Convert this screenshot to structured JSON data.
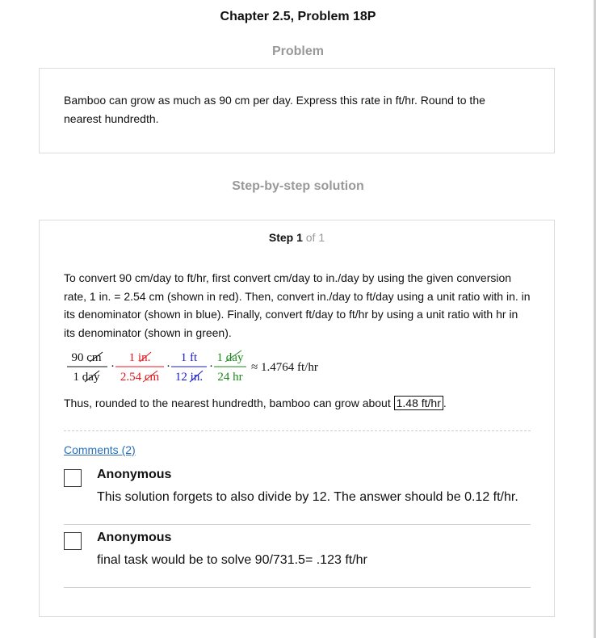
{
  "page": {
    "title": "Chapter 2.5, Problem 18P",
    "problem_label": "Problem",
    "solution_label": "Step-by-step solution"
  },
  "problem": {
    "text": "Bamboo can grow as much as 90 cm per day. Express this rate in ft/hr. Round to the nearest hundredth."
  },
  "step": {
    "label": "Step 1",
    "of": "of 1",
    "explanation": "To convert 90 cm/day to ft/hr, first convert cm/day to in./day by using the given conversion rate, 1 in. = 2.54 cm (shown in red). Then, convert in./day to ft/day using a unit ratio with in. in its denominator (shown in blue). Finally, convert ft/day to ft/hr by using a unit ratio with hr in its denominator (shown in green).",
    "equation": {
      "f1_num": "90 cm",
      "f1_den": "1 day",
      "f2_num": "1 in.",
      "f2_den": "2.54 cm",
      "f3_num": "1 ft",
      "f3_den": "12 in.",
      "f4_num": "1 day",
      "f4_den": "24 hr",
      "result": "≈ 1.4764 ft/hr",
      "colors": {
        "red": "#e8161c",
        "blue": "#1a1ad6",
        "green": "#1b8a1b"
      }
    },
    "conclusion_prefix": "Thus, rounded to the nearest hundredth, bamboo can grow about",
    "answer": "1.48 ft/hr",
    "conclusion_suffix": "."
  },
  "comments": {
    "link": "Comments (2)",
    "items": [
      {
        "author": "Anonymous",
        "text": "This solution forgets to also divide by 12. The answer should be 0.12 ft/hr."
      },
      {
        "author": "Anonymous",
        "text": "final task would be to solve 90/731.5= .123 ft/hr"
      }
    ]
  }
}
